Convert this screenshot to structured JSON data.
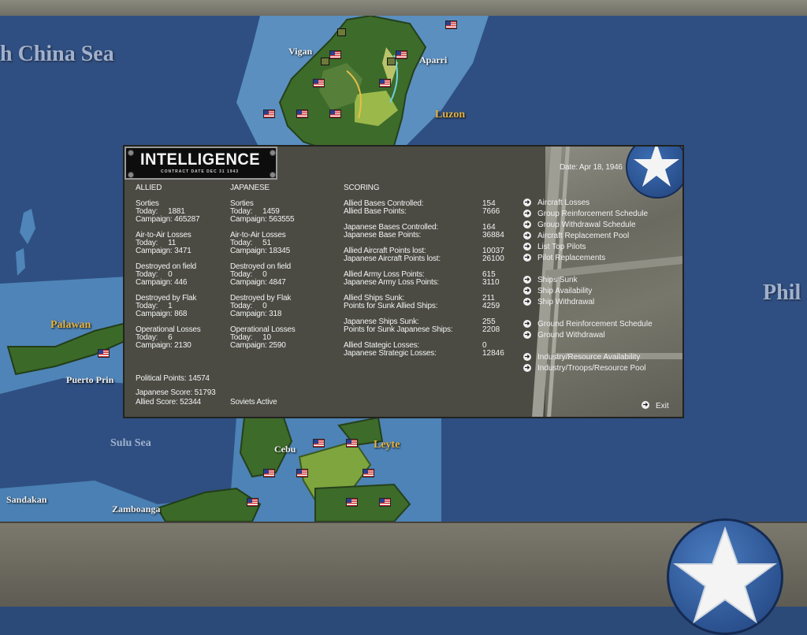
{
  "map": {
    "labels": {
      "sea_north": "h China Sea",
      "vigan": "Vigan",
      "aparri": "Aparri",
      "luzon": "Luzon",
      "palawan": "Palawan",
      "puerto": "Puerto Prin",
      "phil": "Phil",
      "sulu": "Sulu Sea",
      "cebu": "Cebu",
      "leyte": "Leyte",
      "sandakan": "Sandakan",
      "zamboanga": "Zamboanga"
    }
  },
  "panel": {
    "title": "INTELLIGENCE",
    "subtitle": "CONTRACT DATE DEC 31 1943",
    "date": "Date: Apr 18, 1946",
    "allied": {
      "header": "ALLIED",
      "sorties_label": "Sorties",
      "sorties_today": "Today:     1881",
      "sorties_campaign": "Campaign: 465287",
      "a2a_label": "Air-to-Air Losses",
      "a2a_today": "Today:     11",
      "a2a_campaign": "Campaign: 3471",
      "dof_label": "Destroyed on field",
      "dof_today": "Today:     0",
      "dof_campaign": "Campaign: 446",
      "flak_label": "Destroyed by Flak",
      "flak_today": "Today:     1",
      "flak_campaign": "Campaign: 868",
      "ops_label": "Operational Losses",
      "ops_today": "Today:     6",
      "ops_campaign": "Campaign: 2130"
    },
    "japanese": {
      "header": "JAPANESE",
      "sorties_label": "Sorties",
      "sorties_today": "Today:     1459",
      "sorties_campaign": "Campaign: 563555",
      "a2a_label": "Air-to-Air Losses",
      "a2a_today": "Today:     51",
      "a2a_campaign": "Campaign: 18345",
      "dof_label": "Destroyed on field",
      "dof_today": "Today:     0",
      "dof_campaign": "Campaign: 4847",
      "flak_label": "Destroyed by Flak",
      "flak_today": "Today:     0",
      "flak_campaign": "Campaign: 318",
      "ops_label": "Operational Losses",
      "ops_today": "Today:     10",
      "ops_campaign": "Campaign: 2590"
    },
    "political": "Political Points: 14574",
    "japanese_score": "Japanese Score: 51793",
    "allied_score": "Allied Score: 52344",
    "soviets": "Soviets Active",
    "scoring": {
      "header": "SCORING",
      "rows": [
        {
          "label": "Allied Bases Controlled:",
          "value": "154"
        },
        {
          "label": "Allied Base Points:",
          "value": "7666"
        },
        {
          "label": "Japanese Bases Controlled:",
          "value": "164"
        },
        {
          "label": "Japanese Base Points:",
          "value": "36884"
        },
        {
          "label": "Allied Aircraft Points lost:",
          "value": "10037"
        },
        {
          "label": "Japanese Aircraft Points lost:",
          "value": "26100"
        },
        {
          "label": "Allied Army Loss Points:",
          "value": "615"
        },
        {
          "label": "Japanese Army Loss Points:",
          "value": "3110"
        },
        {
          "label": "Allied Ships Sunk:",
          "value": "211"
        },
        {
          "label": "Points for Sunk Allied Ships:",
          "value": "4259"
        },
        {
          "label": "Japanese Ships Sunk:",
          "value": "255"
        },
        {
          "label": "Points for Sunk Japanese Ships:",
          "value": "2208"
        },
        {
          "label": "Allied Stategic Losses:",
          "value": "0"
        },
        {
          "label": "Japanese Strategic Losses:",
          "value": "12846"
        }
      ]
    },
    "links": [
      "Aircraft Losses",
      "Group Reinforcement Schedule",
      "Group Withdrawal Schedule",
      "Aircraft Replacement Pool",
      "List Top Pilots",
      "Pilot Replacements",
      "Ships Sunk",
      "Ship Availability",
      "Ship Withdrawal",
      "Ground Reinforcement Schedule",
      "Ground Withdrawal",
      "Industry/Resource Availability",
      "Industry/Troops/Resource Pool"
    ],
    "exit": "Exit"
  }
}
